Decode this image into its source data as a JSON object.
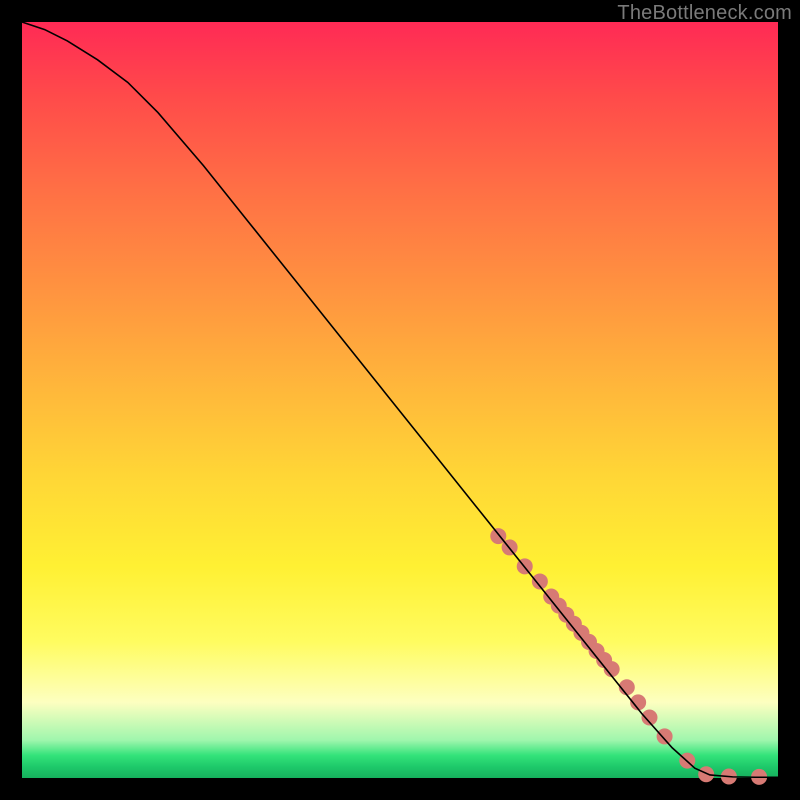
{
  "watermark": "TheBottleneck.com",
  "chart_data": {
    "type": "line",
    "title": "",
    "xlabel": "",
    "ylabel": "",
    "xlim": [
      0,
      100
    ],
    "ylim": [
      0,
      100
    ],
    "grid": false,
    "legend": false,
    "series": [
      {
        "name": "curve",
        "color": "#000000",
        "x": [
          0,
          3,
          6,
          10,
          14,
          18,
          24,
          30,
          36,
          42,
          48,
          54,
          60,
          66,
          72,
          78,
          82,
          86,
          89,
          91,
          94,
          97,
          100
        ],
        "y": [
          100,
          99,
          97.5,
          95,
          92,
          88,
          81,
          73.5,
          66,
          58.5,
          51,
          43.5,
          36,
          28.5,
          21,
          13.5,
          8.5,
          4,
          1.3,
          0.4,
          0.15,
          0.1,
          0.1
        ]
      }
    ],
    "markers": {
      "name": "dots",
      "color": "#d77a74",
      "radius_px": 8,
      "x": [
        63,
        64.5,
        66.5,
        68.5,
        70,
        71,
        72,
        73,
        74,
        75,
        76,
        77,
        78,
        80,
        81.5,
        83,
        85,
        88,
        90.5,
        93.5,
        97.5
      ],
      "y": [
        32,
        30.5,
        28,
        26,
        24,
        22.8,
        21.6,
        20.4,
        19.2,
        18,
        16.8,
        15.6,
        14.4,
        12,
        10,
        8,
        5.5,
        2.3,
        0.5,
        0.2,
        0.15
      ]
    }
  }
}
